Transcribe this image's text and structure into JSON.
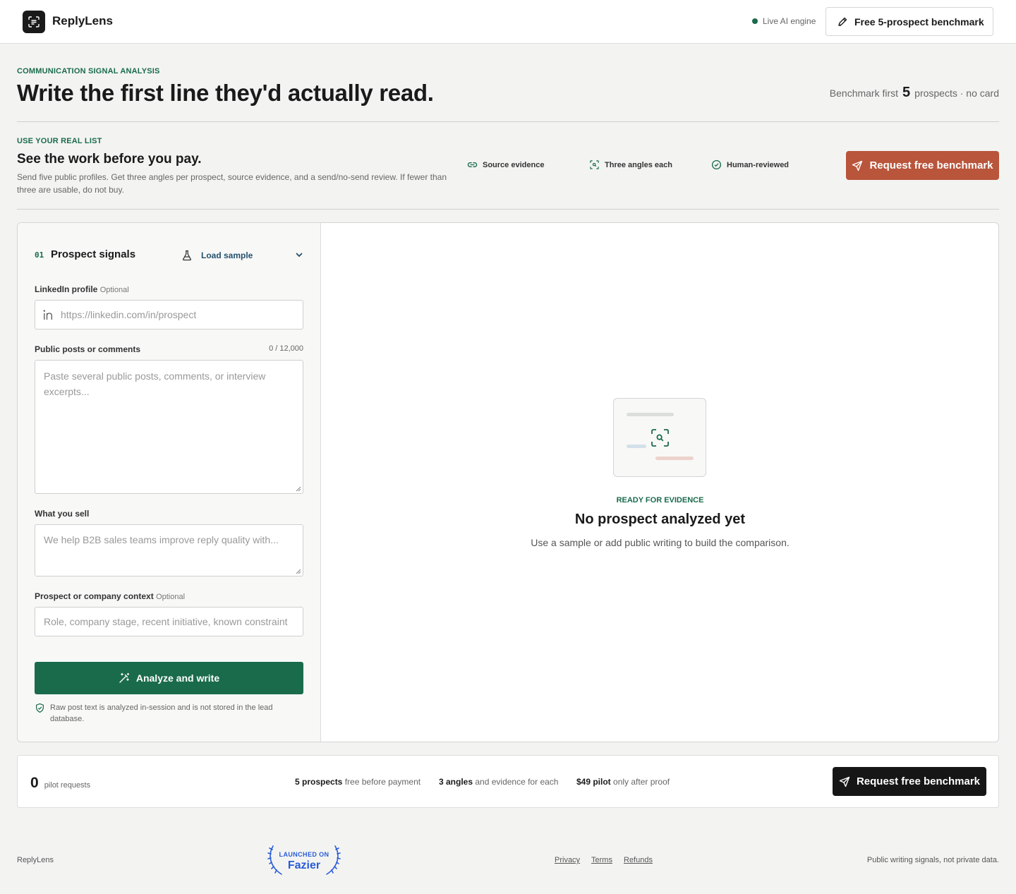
{
  "header": {
    "brand": "ReplyLens",
    "live_label": "Live AI engine",
    "top_button": "Free 5-prospect benchmark",
    "colors": {
      "live_dot": "#1a6b4b"
    }
  },
  "hero": {
    "eyebrow": "COMMUNICATION SIGNAL ANALYSIS",
    "title": "Write the first line they'd actually read.",
    "right_prefix": "Benchmark first",
    "right_number": "5",
    "right_suffix": "prospects · no card"
  },
  "pay": {
    "eyebrow": "USE YOUR REAL LIST",
    "title": "See the work before you pay.",
    "description": "Send five public profiles. Get three angles per prospect, source evidence, and a send/no-send review. If fewer than three are usable, do not buy.",
    "features": [
      {
        "label": "Source evidence",
        "icon": "link-icon"
      },
      {
        "label": "Three angles each",
        "icon": "scan-icon"
      },
      {
        "label": "Human-reviewed",
        "icon": "check-circle-icon"
      }
    ],
    "cta": "Request free benchmark",
    "cta_color": "#b9553b"
  },
  "form": {
    "step": "01",
    "title": "Prospect signals",
    "load_sample": "Load sample",
    "linkedin": {
      "label": "LinkedIn profile",
      "optional": "Optional",
      "placeholder": "https://linkedin.com/in/prospect",
      "value": ""
    },
    "posts": {
      "label": "Public posts or comments",
      "counter": "0 / 12,000",
      "placeholder": "Paste several public posts, comments, or interview excerpts...",
      "value": ""
    },
    "sell": {
      "label": "What you sell",
      "placeholder": "We help B2B sales teams improve reply quality with...",
      "value": ""
    },
    "context": {
      "label": "Prospect or company context",
      "optional": "Optional",
      "placeholder": "Role, company stage, recent initiative, known constraint",
      "value": ""
    },
    "submit": "Analyze and write",
    "privacy_note": "Raw post text is analyzed in-session and is not stored in the lead database.",
    "accent": "#1a6b4b"
  },
  "empty_state": {
    "eyebrow": "READY FOR EVIDENCE",
    "title": "No prospect analyzed yet",
    "subtitle": "Use a sample or add public writing to build the comparison."
  },
  "stats": {
    "count": "0",
    "count_label": "pilot requests",
    "items": [
      {
        "bold": "5 prospects",
        "rest": "free before payment"
      },
      {
        "bold": "3 angles",
        "rest": "and evidence for each"
      },
      {
        "bold": "$49 pilot",
        "rest": "only after proof"
      }
    ],
    "cta": "Request free benchmark"
  },
  "footer": {
    "brand": "ReplyLens",
    "badge_top": "LAUNCHED ON",
    "badge_name": "Fazier",
    "links": [
      "Privacy",
      "Terms",
      "Refunds"
    ],
    "tagline": "Public writing signals, not private data."
  }
}
